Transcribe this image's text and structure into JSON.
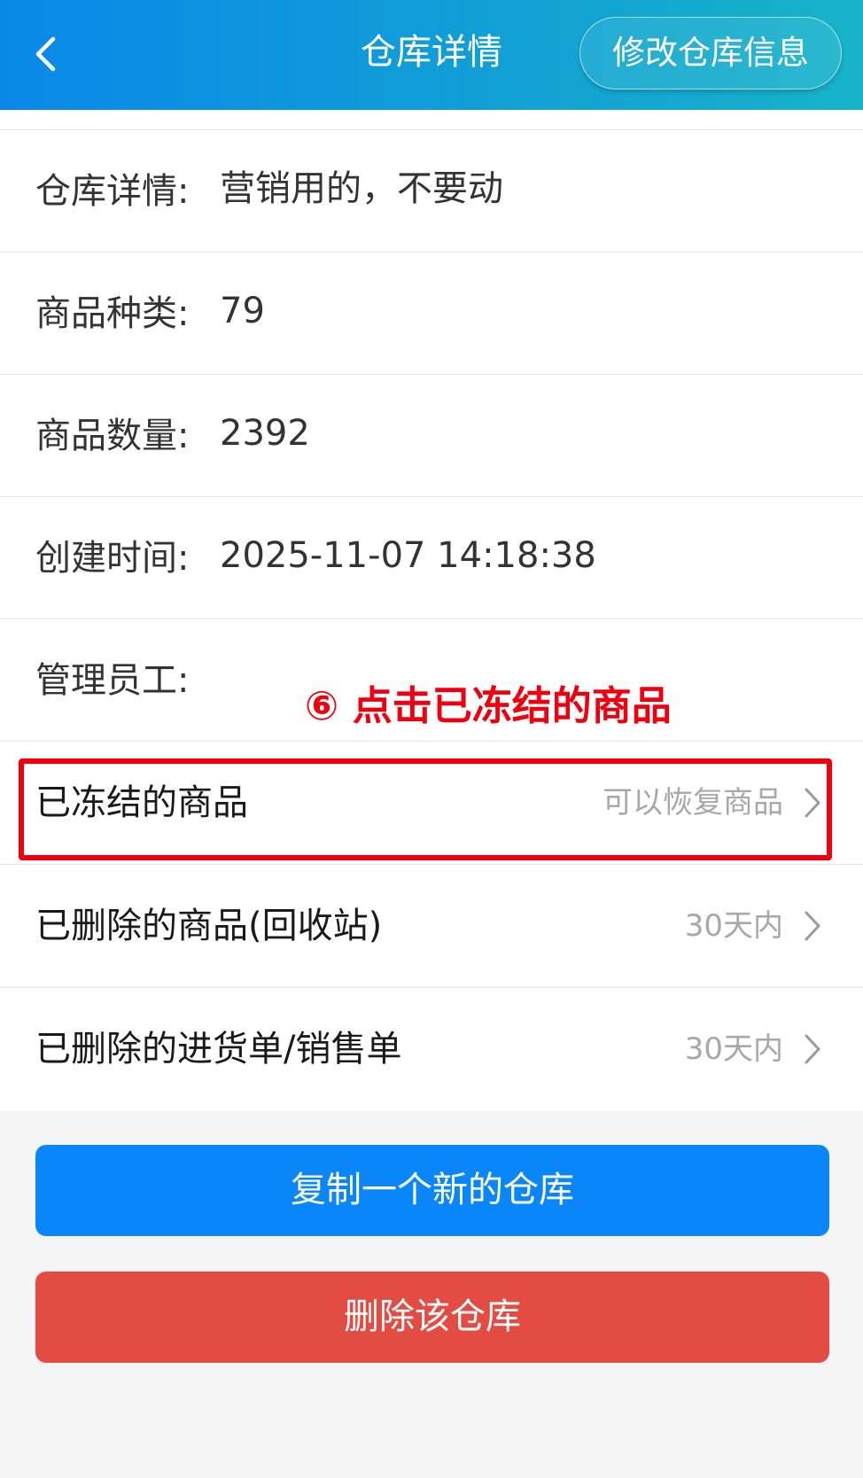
{
  "header": {
    "title": "仓库详情",
    "edit_label": "修改仓库信息"
  },
  "info_rows": [
    {
      "label": "仓库详情:",
      "value": "营销用的，不要动"
    },
    {
      "label": "商品种类:",
      "value": "79"
    },
    {
      "label": "商品数量:",
      "value": "2392"
    },
    {
      "label": "创建时间:",
      "value": "2025-11-07 14:18:38"
    },
    {
      "label": "管理员工:",
      "value": ""
    }
  ],
  "nav_rows": [
    {
      "label": "已冻结的商品",
      "hint": "可以恢复商品"
    },
    {
      "label": "已删除的商品(回收站)",
      "hint": "30天内"
    },
    {
      "label": "已删除的进货单/销售单",
      "hint": "30天内"
    }
  ],
  "annotation": {
    "text": "⑥ 点击已冻结的商品",
    "color": "#f0000e"
  },
  "actions": {
    "copy_label": "复制一个新的仓库",
    "delete_label": "删除该仓库"
  },
  "colors": {
    "header_start": "#0a88e8",
    "header_end": "#18b3c9",
    "primary_button": "#0a86f8",
    "danger_button": "#e24c42"
  }
}
